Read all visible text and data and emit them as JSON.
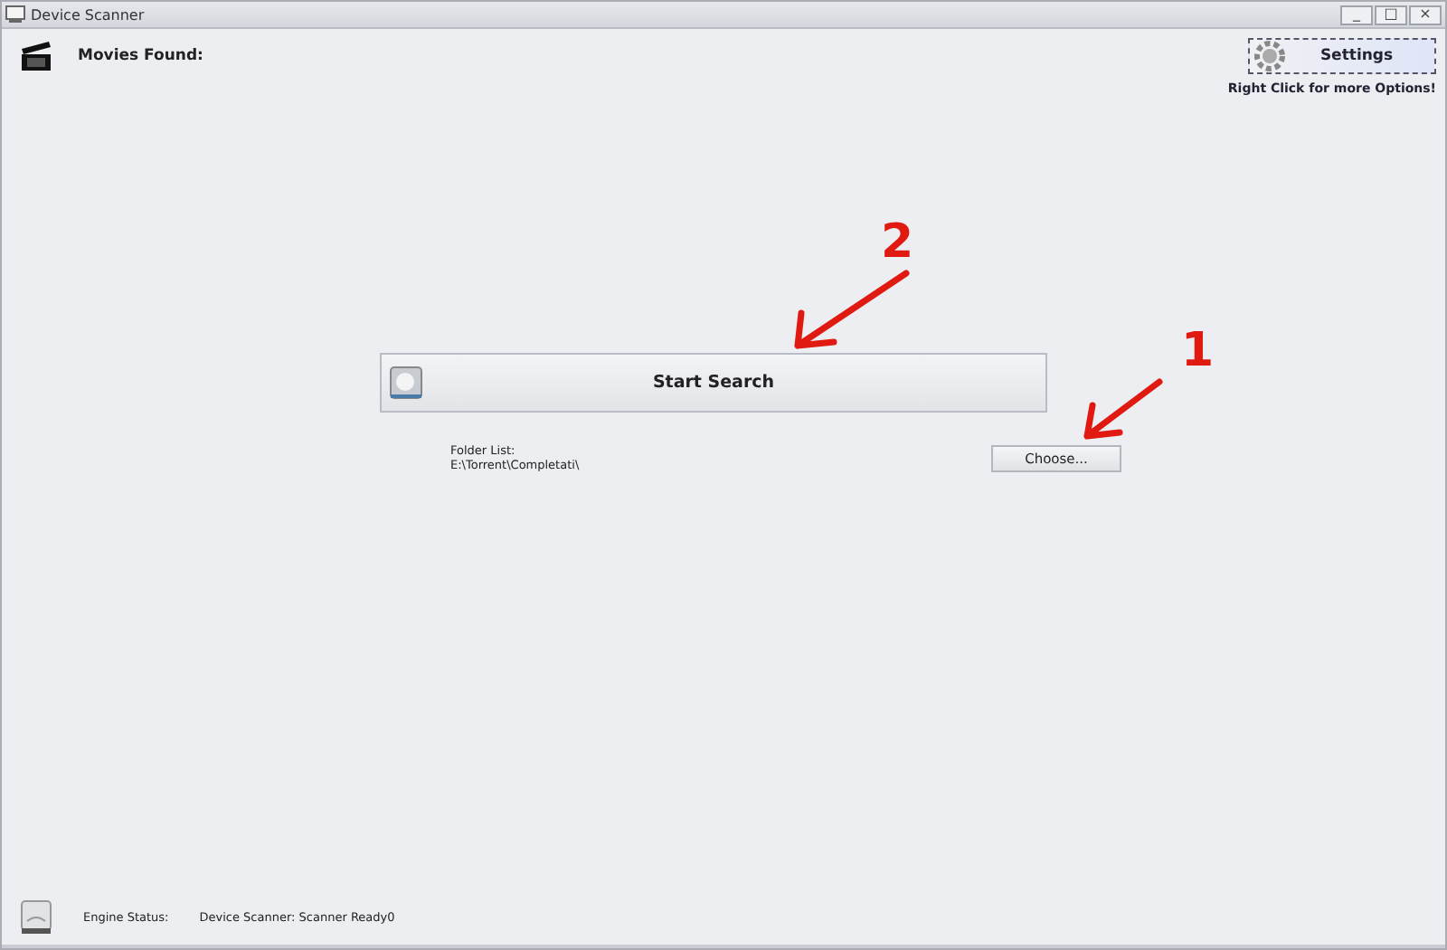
{
  "window": {
    "title": "Device Scanner",
    "controls": [
      "_",
      "□",
      "×"
    ]
  },
  "header": {
    "label": "Movies Found:"
  },
  "settings": {
    "button": "Settings",
    "hint": "Right Click for more Options!"
  },
  "search_button": "Start Search",
  "folder": {
    "label": "Folder List:",
    "path": "E:\\Torrent\\Completati\\",
    "choose_button": "Choose..."
  },
  "status_bar": {
    "label": "Engine Status:",
    "value": "Device Scanner: Scanner Ready0"
  },
  "annotations": [
    {
      "label": "2",
      "kind": "search"
    },
    {
      "label": "1",
      "kind": "choose"
    }
  ]
}
